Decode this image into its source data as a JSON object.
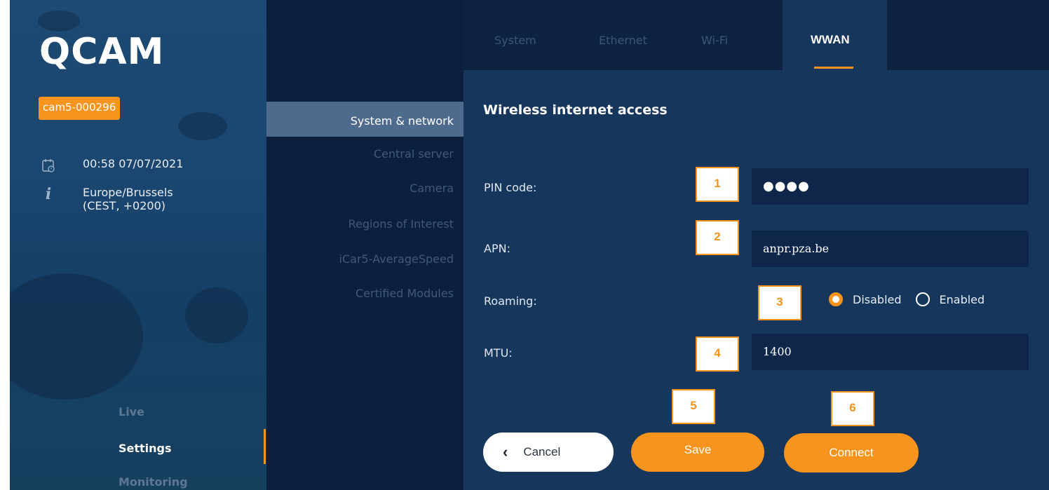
{
  "app": {
    "logo": "QCAM",
    "device_id": "cam5-000296",
    "datetime": "00:58 07/07/2021",
    "timezone_line1": "Europe/Brussels",
    "timezone_line2": "(CEST, +0200)",
    "calendar_icon": "calendar-clock-icon",
    "info_icon": "info-icon"
  },
  "nav": {
    "live": "Live",
    "settings": "Settings",
    "monitoring": "Monitoring",
    "active": "Settings"
  },
  "subnav": {
    "items": [
      "System & network",
      "Central server",
      "Camera",
      "Regions of Interest",
      "iCar5-AverageSpeed",
      "Certified Modules"
    ],
    "active": "System & network"
  },
  "tabs": {
    "items": [
      "System",
      "Ethernet",
      "Wi-Fi",
      "WWAN"
    ],
    "active": "WWAN"
  },
  "form": {
    "title": "Wireless internet access",
    "pin_label": "PIN code:",
    "pin_value": "●●●●",
    "apn_label": "APN:",
    "apn_value": "anpr.pza.be",
    "roaming_label": "Roaming:",
    "roaming_options": [
      "Disabled",
      "Enabled"
    ],
    "roaming_selected": "Disabled",
    "mtu_label": "MTU:",
    "mtu_value": "1400"
  },
  "markers": [
    "1",
    "2",
    "3",
    "4",
    "5",
    "6"
  ],
  "buttons": {
    "cancel": "Cancel",
    "save": "Save",
    "connect": "Connect"
  },
  "colors": {
    "accent": "#f7941d",
    "sidebar": "#1a4670",
    "subnav": "#0b1f3e",
    "main": "#17365c",
    "input": "#0e2649"
  }
}
